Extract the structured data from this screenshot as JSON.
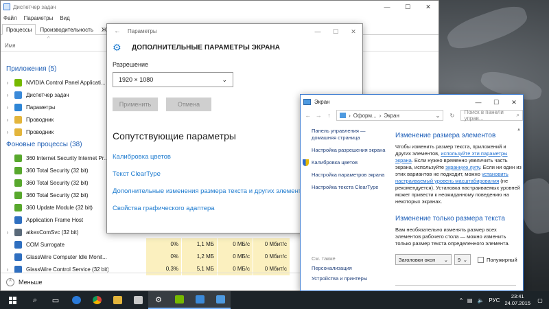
{
  "desktop": {},
  "task_manager": {
    "title": "Диспетчер задач",
    "menu": [
      "Файл",
      "Параметры",
      "Вид"
    ],
    "tabs": [
      "Процессы",
      "Производительность",
      "Журнал"
    ],
    "column_name": "Имя",
    "groups": {
      "apps_label": "Приложения (5)",
      "background_label": "Фоновые процессы (38)"
    },
    "apps": [
      {
        "name": "NVIDIA Control Panel Applicati...",
        "color": "#76b900"
      },
      {
        "name": "Диспетчер задач",
        "color": "#3b8ad9"
      },
      {
        "name": "Параметры",
        "color": "#2f86d6"
      },
      {
        "name": "Проводник",
        "color": "#e3b53c"
      },
      {
        "name": "Проводник",
        "color": "#e3b53c"
      }
    ],
    "background": [
      {
        "name": "360 Internet Security Internet Pr...",
        "color": "#58a82d",
        "cpu": "",
        "mem": "",
        "disk": "",
        "net": ""
      },
      {
        "name": "360 Total Security (32 bit)",
        "color": "#58a82d",
        "cpu": "",
        "mem": "",
        "disk": "",
        "net": ""
      },
      {
        "name": "360 Total Security (32 bit)",
        "color": "#58a82d",
        "cpu": "",
        "mem": "",
        "disk": "",
        "net": ""
      },
      {
        "name": "360 Total Security (32 bit)",
        "color": "#58a82d",
        "cpu": "",
        "mem": "",
        "disk": "",
        "net": ""
      },
      {
        "name": "360 Update Module (32 bit)",
        "color": "#58a82d",
        "cpu": "",
        "mem": "",
        "disk": "",
        "net": ""
      },
      {
        "name": "Application Frame Host",
        "color": "#2f6fc0",
        "cpu": "",
        "mem": "",
        "disk": "",
        "net": ""
      },
      {
        "name": "atkexComSvc (32 bit)",
        "color": "#5a6a7a",
        "cpu": "",
        "mem": "",
        "disk": "",
        "net": ""
      },
      {
        "name": "COM Surrogate",
        "color": "#2f6fc0",
        "cpu": "0%",
        "mem": "1,1 МБ",
        "disk": "0 МБ/с",
        "net": "0 Мбит/с"
      },
      {
        "name": "GlassWire Computer Idle Monit...",
        "color": "#2f6fc0",
        "cpu": "0%",
        "mem": "1,2 МБ",
        "disk": "0 МБ/с",
        "net": "0 Мбит/с"
      },
      {
        "name": "GlassWire Control Service (32 bit)",
        "color": "#2f6fc0",
        "cpu": "0,3%",
        "mem": "5,1 МБ",
        "disk": "0 МБ/с",
        "net": "0 Мбит/с"
      }
    ],
    "footer_label": "Меньше"
  },
  "settings": {
    "title": "Параметры",
    "header": "ДОПОЛНИТЕЛЬНЫЕ ПАРАМЕТРЫ ЭКРАНА",
    "resolution_label": "Разрешение",
    "resolution_value": "1920 × 1080",
    "apply_label": "Применить",
    "cancel_label": "Отмена",
    "related_heading": "Сопутствующие параметры",
    "links": [
      "Калибровка цветов",
      "Текст ClearType",
      "Дополнительные изменения размера текста и других элементов",
      "Свойства графического адаптера"
    ]
  },
  "control_panel": {
    "title": "Экран",
    "path": [
      "Оформ...",
      "Экран"
    ],
    "search_placeholder": "Поиск в панели управ...",
    "left_links": [
      "Панель управления — домашняя страница",
      "Настройка разрешения экрана",
      "Калибровка цветов",
      "Настройка параметров экрана",
      "Настройка текста ClearType"
    ],
    "see_also": "См. также",
    "bottom_links": [
      "Персонализация",
      "Устройства и принтеры"
    ],
    "heading1": "Изменение размера элементов",
    "para1_a": "Чтобы изменить размер текста, приложений и других элементов, ",
    "para1_link1": "используйте эти параметры экрана",
    "para1_b": ". Если нужно временно увеличить часть экрана, используйте ",
    "para1_link2": "экранную лупу",
    "para1_c": ". Если ни один из этих вариантов не подходит, можно ",
    "para1_link3": "установить настраиваемый уровень масштабирования",
    "para1_d": " (не рекомендуется). Установка настраиваемых уровней может привести к неожиданному поведению на некоторых экранах.",
    "heading2": "Изменение только размера текста",
    "para2": "Вам необязательно изменять размер всех элементов рабочего стола — можно изменить только размер текста определенного элемента.",
    "element_select": "Заголовки окон",
    "size_select": "9",
    "bold_label": "Полужирный"
  },
  "taskbar": {
    "lang": "РУС",
    "time": "23:41",
    "date": "24.07.2015"
  }
}
